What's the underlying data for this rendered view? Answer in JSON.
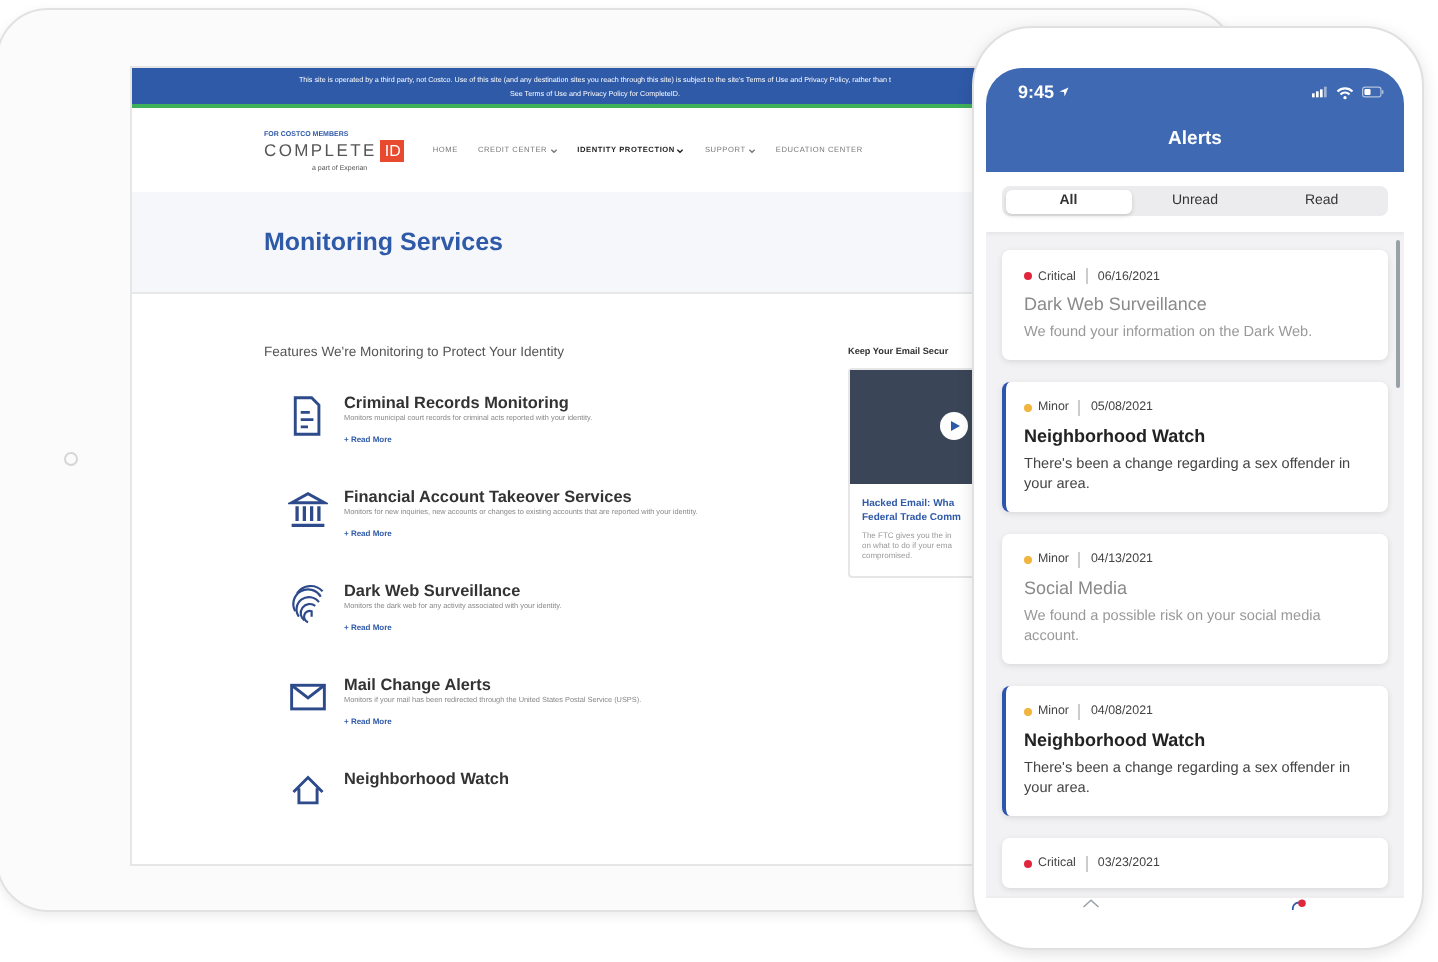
{
  "tablet": {
    "banner": {
      "notice": "This site is operated by a third party, not Costco. Use of this site (and any destination sites you reach through this site) is subject to the site's Terms of Use and Privacy Policy, rather than t",
      "links_line": "See Terms of Use and Privacy Policy for CompleteID."
    },
    "logo": {
      "tagline": "FOR COSTCO MEMBERS",
      "wordmark": "COMPLETE",
      "badge": "ID",
      "partner": "a part of Experian"
    },
    "nav": [
      {
        "label": "HOME",
        "dropdown": false,
        "selected": false
      },
      {
        "label": "CREDIT CENTER",
        "dropdown": true,
        "selected": false
      },
      {
        "label": "IDENTITY PROTECTION",
        "dropdown": true,
        "selected": true
      },
      {
        "label": "SUPPORT",
        "dropdown": true,
        "selected": false
      },
      {
        "label": "EDUCATION CENTER",
        "dropdown": false,
        "selected": false
      }
    ],
    "page_title": "Monitoring Services",
    "section_heading": "Features We're Monitoring to Protect Your Identity",
    "features": [
      {
        "kind": "document",
        "title": "Criminal Records Monitoring",
        "description": "Monitors municipal court records for criminal acts reported with your identity.",
        "link": "+ Read More"
      },
      {
        "kind": "bank",
        "title": "Financial Account Takeover Services",
        "description": "Monitors for new inquiries, new accounts or changes to existing accounts that are reported with your identity.",
        "link": "+ Read More"
      },
      {
        "kind": "fingerprint",
        "title": "Dark Web Surveillance",
        "description": "Monitors the dark web for any activity associated with your identity.",
        "link": "+ Read More"
      },
      {
        "kind": "mail",
        "title": "Mail Change Alerts",
        "description": "Monitors if your mail has been redirected through the United States Postal Service (USPS).",
        "link": "+ Read More"
      },
      {
        "kind": "house",
        "title": "Neighborhood Watch"
      }
    ],
    "sidebar": {
      "heading": "Keep Your Email Secur",
      "article": {
        "title_lines": [
          "Hacked Email: Wha",
          "Federal Trade Comm"
        ],
        "summary_lines": [
          "The FTC gives you the in",
          "on what to do if your ema",
          "compromised."
        ]
      }
    }
  },
  "phone": {
    "status_bar": {
      "time": "9:45"
    },
    "title": "Alerts",
    "segments": [
      {
        "label": "All",
        "selected": true
      },
      {
        "label": "Unread",
        "selected": false
      },
      {
        "label": "Read",
        "selected": false
      }
    ],
    "alerts": [
      {
        "severity": "Critical",
        "color": "#e0263c",
        "date": "06/16/2021",
        "title": "Dark Web Surveillance",
        "message": "We found your information on the Dark Web.",
        "unread": false
      },
      {
        "severity": "Minor",
        "color": "#f2b43a",
        "date": "05/08/2021",
        "title": "Neighborhood Watch",
        "message": "There's been a change regarding a sex offender in your area.",
        "unread": true
      },
      {
        "severity": "Minor",
        "color": "#f2b43a",
        "date": "04/13/2021",
        "title": "Social Media",
        "message": "We found a possible risk on your social media account.",
        "unread": false
      },
      {
        "severity": "Minor",
        "color": "#f2b43a",
        "date": "04/08/2021",
        "title": "Neighborhood Watch",
        "message": "There's been a change regarding a sex offender in your area.",
        "unread": true
      },
      {
        "severity": "Critical",
        "color": "#e0263c",
        "date": "03/23/2021",
        "unread": false
      }
    ]
  }
}
